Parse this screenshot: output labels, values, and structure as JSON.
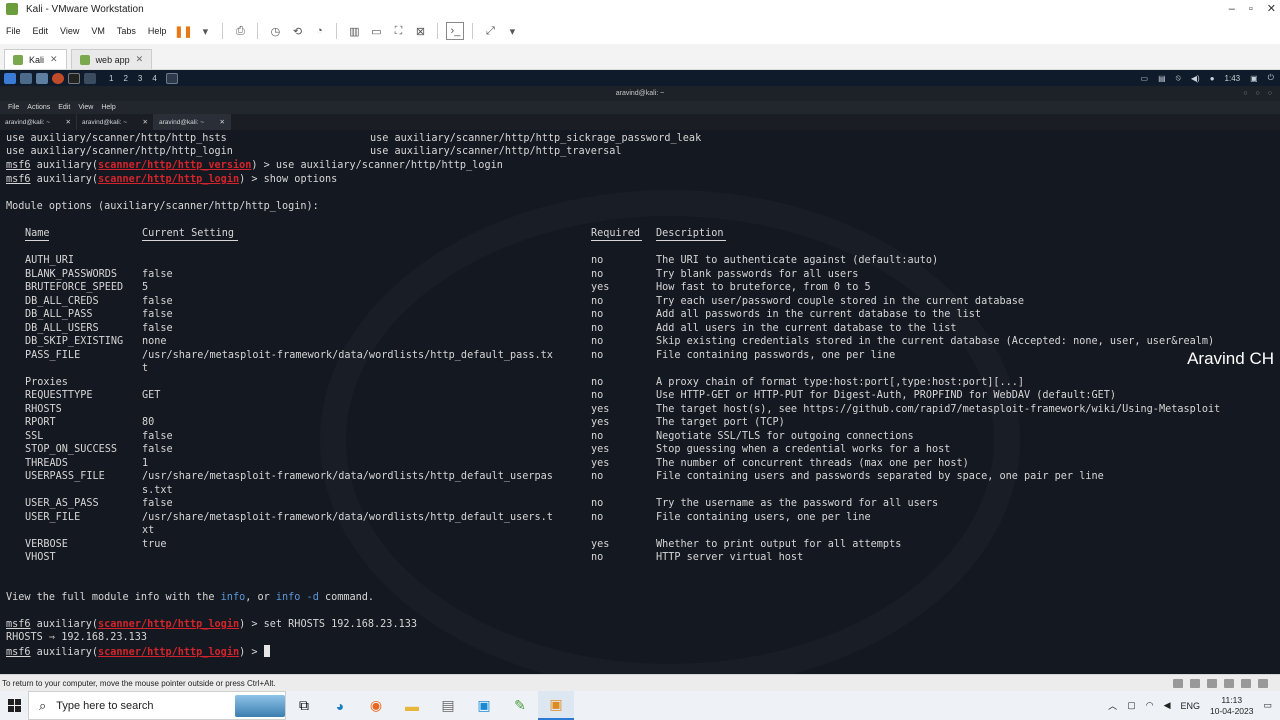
{
  "vmware": {
    "title": "Kali - VMware Workstation",
    "menu": [
      "File",
      "Edit",
      "View",
      "VM",
      "Tabs",
      "Help"
    ],
    "tabs": [
      {
        "label": "Kali",
        "active": true
      },
      {
        "label": "web app",
        "active": false
      }
    ],
    "status_text": "To return to your computer, move the mouse pointer outside or press Ctrl+Alt."
  },
  "kali_panel": {
    "workspaces": [
      "1",
      "2",
      "3",
      "4"
    ],
    "clock": "1:43"
  },
  "terminal": {
    "window_title": "aravind@kali: ~",
    "menu": [
      "File",
      "Actions",
      "Edit",
      "View",
      "Help"
    ],
    "tabs": [
      {
        "label": "aravind@kali: ~"
      },
      {
        "label": "aravind@kali: ~"
      },
      {
        "label": "aravind@kali: ~"
      }
    ],
    "use_lines": [
      {
        "left": "use auxiliary/scanner/http/http_hsts",
        "right": "use auxiliary/scanner/http/http_sickrage_password_leak"
      },
      {
        "left": "use auxiliary/scanner/http/http_login",
        "right": "use auxiliary/scanner/http/http_traversal"
      }
    ],
    "prompt_prefix": "msf6",
    "prompt_mid": " auxiliary(",
    "prompt_suffix": ") > ",
    "cmd1": {
      "module": "scanner/http/http_version",
      "command": "use auxiliary/scanner/http/http_login"
    },
    "cmd2": {
      "module": "scanner/http/http_login",
      "command": "show options"
    },
    "options_heading": "Module options (auxiliary/scanner/http/http_login):",
    "columns": {
      "name": "Name",
      "setting": "Current Setting",
      "required": "Required",
      "description": "Description"
    },
    "options": [
      {
        "name": "AUTH_URI",
        "setting": "",
        "required": "no",
        "description": "The URI to authenticate against (default:auto)"
      },
      {
        "name": "BLANK_PASSWORDS",
        "setting": "false",
        "required": "no",
        "description": "Try blank passwords for all users"
      },
      {
        "name": "BRUTEFORCE_SPEED",
        "setting": "5",
        "required": "yes",
        "description": "How fast to bruteforce, from 0 to 5"
      },
      {
        "name": "DB_ALL_CREDS",
        "setting": "false",
        "required": "no",
        "description": "Try each user/password couple stored in the current database"
      },
      {
        "name": "DB_ALL_PASS",
        "setting": "false",
        "required": "no",
        "description": "Add all passwords in the current database to the list"
      },
      {
        "name": "DB_ALL_USERS",
        "setting": "false",
        "required": "no",
        "description": "Add all users in the current database to the list"
      },
      {
        "name": "DB_SKIP_EXISTING",
        "setting": "none",
        "required": "no",
        "description": "Skip existing credentials stored in the current database (Accepted: none, user, user&realm)"
      },
      {
        "name": "PASS_FILE",
        "setting": "/usr/share/metasploit-framework/data/wordlists/http_default_pass.tx",
        "setting_wrap": "t",
        "required": "no",
        "description": "File containing passwords, one per line"
      },
      {
        "name": "Proxies",
        "setting": "",
        "required": "no",
        "description": "A proxy chain of format type:host:port[,type:host:port][...]"
      },
      {
        "name": "REQUESTTYPE",
        "setting": "GET",
        "required": "no",
        "description": "Use HTTP-GET or HTTP-PUT for Digest-Auth, PROPFIND for WebDAV (default:GET)"
      },
      {
        "name": "RHOSTS",
        "setting": "",
        "required": "yes",
        "description": "The target host(s), see https://github.com/rapid7/metasploit-framework/wiki/Using-Metasploit"
      },
      {
        "name": "RPORT",
        "setting": "80",
        "required": "yes",
        "description": "The target port (TCP)"
      },
      {
        "name": "SSL",
        "setting": "false",
        "required": "no",
        "description": "Negotiate SSL/TLS for outgoing connections"
      },
      {
        "name": "STOP_ON_SUCCESS",
        "setting": "false",
        "required": "yes",
        "description": "Stop guessing when a credential works for a host"
      },
      {
        "name": "THREADS",
        "setting": "1",
        "required": "yes",
        "description": "The number of concurrent threads (max one per host)"
      },
      {
        "name": "USERPASS_FILE",
        "setting": "/usr/share/metasploit-framework/data/wordlists/http_default_userpas",
        "setting_wrap": "s.txt",
        "required": "no",
        "description": "File containing users and passwords separated by space, one pair per line"
      },
      {
        "name": "USER_AS_PASS",
        "setting": "false",
        "required": "no",
        "description": "Try the username as the password for all users"
      },
      {
        "name": "USER_FILE",
        "setting": "/usr/share/metasploit-framework/data/wordlists/http_default_users.t",
        "setting_wrap": "xt",
        "required": "no",
        "description": "File containing users, one per line"
      },
      {
        "name": "VERBOSE",
        "setting": "true",
        "required": "yes",
        "description": "Whether to print output for all attempts"
      },
      {
        "name": "VHOST",
        "setting": "",
        "required": "no",
        "description": "HTTP server virtual host"
      }
    ],
    "info_line": {
      "pre": "View the full module info with the ",
      "info": "info",
      "mid": ", or ",
      "info_d": "info -d",
      "post": " command."
    },
    "cmd3": {
      "module": "scanner/http/http_login",
      "command": "set RHOSTS 192.168.23.133"
    },
    "rhosts_echo": "RHOSTS ⇒ 192.168.23.133",
    "cmd4": {
      "module": "scanner/http/http_login",
      "command": ""
    }
  },
  "watermark": "Aravind CH",
  "taskbar": {
    "search_placeholder": "Type here to search",
    "lang": "ENG",
    "time": "11:13",
    "date": "10-04-2023"
  }
}
